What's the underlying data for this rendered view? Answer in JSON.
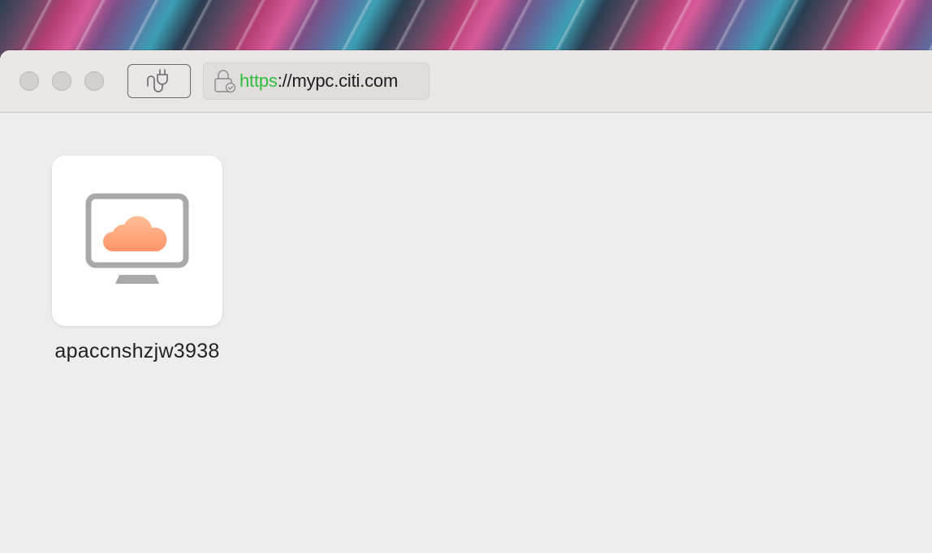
{
  "window": {
    "traffic_lights": [
      "close",
      "minimize",
      "zoom"
    ],
    "connect_button_icon": "plug-icon",
    "url": {
      "scheme": "https",
      "rest": "://mypc.citi.com",
      "secure_icon": "lock-check-icon"
    }
  },
  "desktops": [
    {
      "name": "apaccnshzjw3938",
      "icon": "cloud-desktop-icon"
    }
  ],
  "colors": {
    "url_scheme": "#2ebd3e",
    "cloud_gradient_top": "#ffb48a",
    "cloud_gradient_bottom": "#ff9a70",
    "monitor": "#a9a9a9"
  }
}
